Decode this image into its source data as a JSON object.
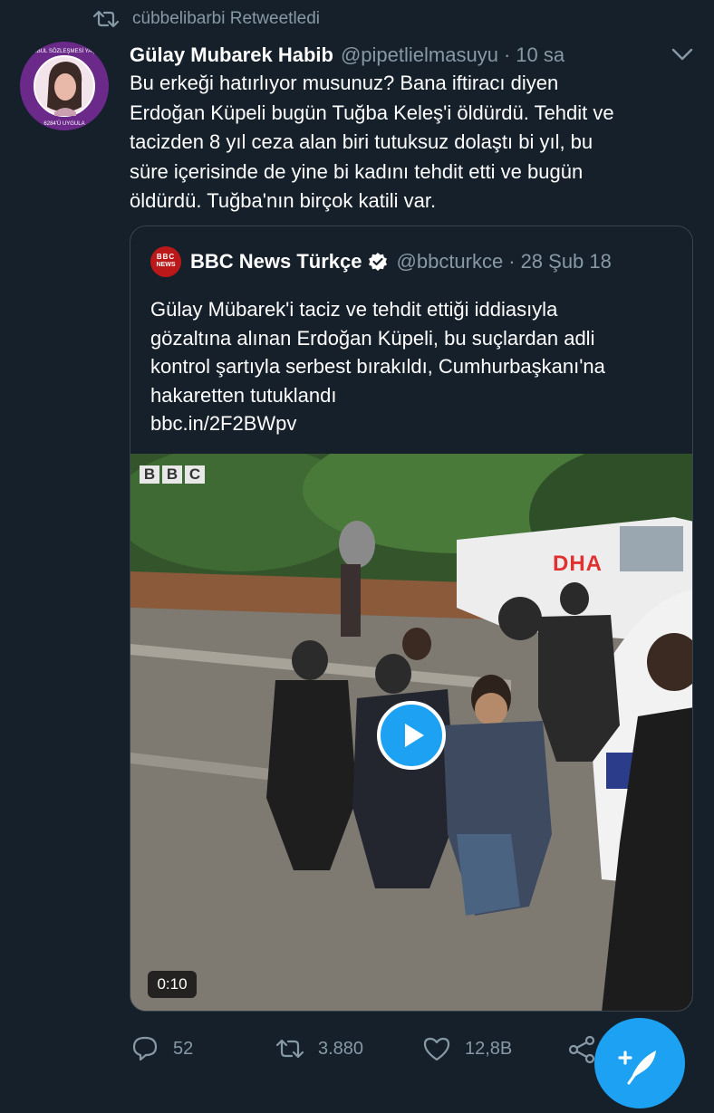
{
  "retweet_context": {
    "icon": "retweet-icon",
    "label": "cübbelibarbi Retweetledi"
  },
  "avatar": {
    "badge_text_top": "İSTANBUL SÖZLEŞMESİ YAŞATIR",
    "badge_text_bottom": "6284'Ü UYGULA",
    "ring_color": "#6b2a8a"
  },
  "tweet": {
    "author_name": "Gülay Mubarek Habib",
    "author_handle": "@pipetlielmasuyu",
    "separator": "·",
    "time": "10 sa",
    "text_lines": [
      "Bu erkeği hatırlıyor musunuz? Bana iftiracı diyen",
      "Erdoğan Küpeli bugün Tuğba Keleş'i öldürdü. Tehdit ve",
      "tacizden 8 yıl ceza alan biri tutuksuz dolaştı bi yıl, bu",
      "süre içerisinde de yine bi kadını tehdit etti ve bugün",
      "öldürdü. Tuğba'nın birçok katili var."
    ]
  },
  "quoted_tweet": {
    "logo_line1": "BBC",
    "logo_line2": "NEWS",
    "author_name": "BBC News Türkçe",
    "verified_icon": "verified-badge-icon",
    "author_handle": "@bbcturkce",
    "separator": "·",
    "date": "28 Şub 18",
    "text_lines": [
      "Gülay Mübarek'i taciz ve tehdit ettiği iddiasıyla",
      "gözaltına alınan Erdoğan Küpeli, bu suçlardan adli",
      "kontrol şartıyla serbest bırakıldı, Cumhurbaşkanı'na",
      "hakaretten tutuklandı",
      "bbc.in/2F2BWpv"
    ],
    "video": {
      "watermark_letters": [
        "B",
        "B",
        "C"
      ],
      "dha_text": "DHA",
      "play_icon": "play-icon",
      "duration": "0:10"
    }
  },
  "actions": {
    "reply": {
      "icon": "reply-icon",
      "count": "52"
    },
    "retweet": {
      "icon": "retweet-icon",
      "count": "3.880"
    },
    "like": {
      "icon": "heart-icon",
      "count": "12,8B"
    },
    "share": {
      "icon": "share-icon"
    }
  },
  "compose_fab": {
    "icon": "compose-tweet-icon"
  },
  "colors": {
    "background": "#15202b",
    "border": "#38444d",
    "secondary_text": "#8899a6",
    "accent": "#1da1f2",
    "bbc_red": "#bb1919"
  }
}
